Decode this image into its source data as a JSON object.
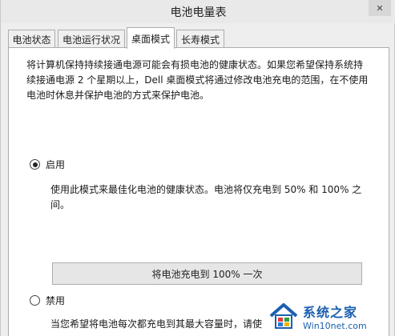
{
  "window": {
    "title": "电池电量表",
    "close_label": "✕"
  },
  "tabs": [
    {
      "label": "电池状态"
    },
    {
      "label": "电池运行状况"
    },
    {
      "label": "桌面模式"
    },
    {
      "label": "长寿模式"
    }
  ],
  "content": {
    "description_line1": "将计算机保持持续接通电源可能会有损电池的健康状态。如果您希望保持系统持",
    "description_line2": "续接通电源 2 个星期以上，Dell 桌面模式将通过修改电池充电的范围，在不使用",
    "description_line3": "电池时休息并保护电池的方式来保护电池。",
    "enable_label": "启用",
    "enable_desc_line1": "使用此模式来最佳化电池的健康状态。电池将仅充电到 50% 和 100% 之",
    "enable_desc_line2": "间。",
    "charge_button": "将电池充电到 100% 一次",
    "disable_label": "禁用",
    "disable_desc_line1": "当您希望将电池每次都充电到其最大容量时，请使"
  },
  "watermark": {
    "title": "系统之家",
    "subtitle": "Win10net.com"
  }
}
